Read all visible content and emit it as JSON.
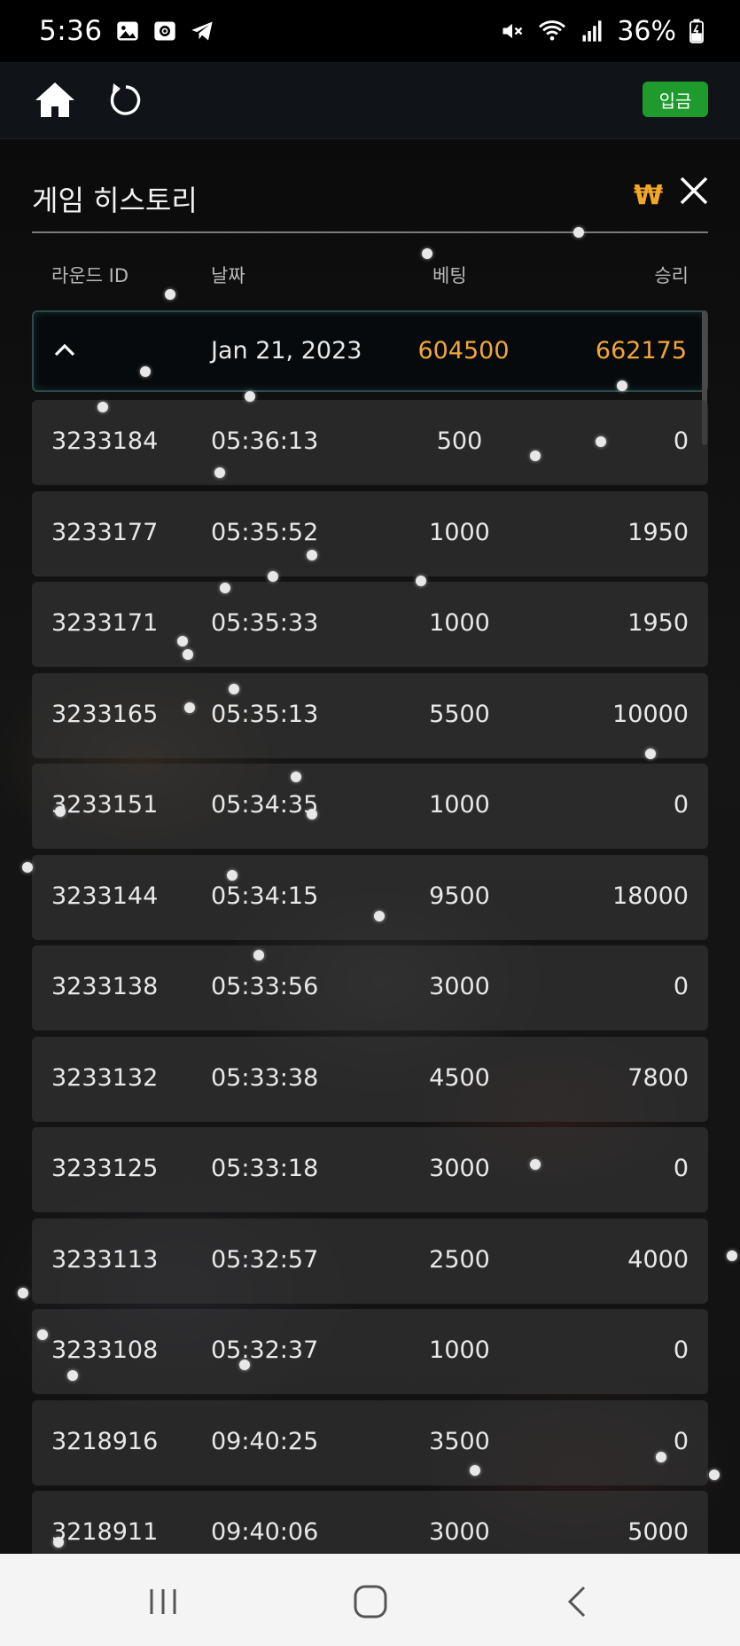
{
  "status_bar": {
    "time": "5:36",
    "battery": "36%",
    "left_icons": [
      "gallery-icon",
      "screen-record-icon",
      "telegram-icon"
    ],
    "right_icons": [
      "mute-icon",
      "wifi-icon",
      "signal-icon",
      "battery-charging-icon"
    ]
  },
  "header": {
    "deposit_label": "입금"
  },
  "panel": {
    "title": "게임 히스토리",
    "currency_symbol": "₩",
    "columns": {
      "round_id": "라운드 ID",
      "date": "날짜",
      "bet": "베팅",
      "win": "승리"
    },
    "group": {
      "date": "Jan 21, 2023",
      "bet_total": "604500",
      "win_total": "662175"
    },
    "rows": [
      {
        "id": "3233184",
        "time": "05:36:13",
        "bet": "500",
        "win": "0"
      },
      {
        "id": "3233177",
        "time": "05:35:52",
        "bet": "1000",
        "win": "1950"
      },
      {
        "id": "3233171",
        "time": "05:35:33",
        "bet": "1000",
        "win": "1950"
      },
      {
        "id": "3233165",
        "time": "05:35:13",
        "bet": "5500",
        "win": "10000"
      },
      {
        "id": "3233151",
        "time": "05:34:35",
        "bet": "1000",
        "win": "0"
      },
      {
        "id": "3233144",
        "time": "05:34:15",
        "bet": "9500",
        "win": "18000"
      },
      {
        "id": "3233138",
        "time": "05:33:56",
        "bet": "3000",
        "win": "0"
      },
      {
        "id": "3233132",
        "time": "05:33:38",
        "bet": "4500",
        "win": "7800"
      },
      {
        "id": "3233125",
        "time": "05:33:18",
        "bet": "3000",
        "win": "0"
      },
      {
        "id": "3233113",
        "time": "05:32:57",
        "bet": "2500",
        "win": "4000"
      },
      {
        "id": "3233108",
        "time": "05:32:37",
        "bet": "1000",
        "win": "0"
      },
      {
        "id": "3218916",
        "time": "09:40:25",
        "bet": "3500",
        "win": "0"
      },
      {
        "id": "3218911",
        "time": "09:40:06",
        "bet": "3000",
        "win": "5000"
      }
    ]
  },
  "colors": {
    "accent": "#f0a63a",
    "deposit_green": "#1f9a2c",
    "currency_gold": "#f3a726"
  },
  "nav_bar": {
    "icons": [
      "recent-apps-icon",
      "home-circle-icon",
      "back-icon"
    ]
  }
}
